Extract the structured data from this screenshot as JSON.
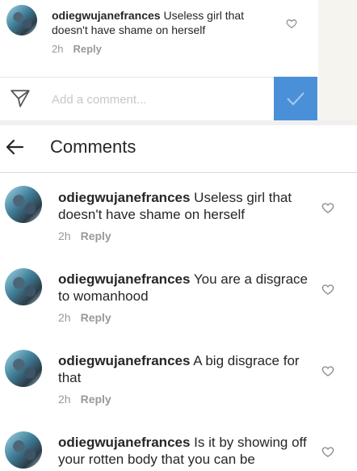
{
  "top_comment": {
    "username": "odiegwujanefrances",
    "text": " Useless girl that doesn't have shame on herself",
    "time": "2h",
    "reply_label": "Reply"
  },
  "composer": {
    "placeholder": "Add a comment..."
  },
  "header": {
    "title": "Comments"
  },
  "comments": [
    {
      "username": "odiegwujanefrances",
      "text": " Useless girl that doesn't have shame on herself",
      "time": "2h",
      "reply_label": "Reply"
    },
    {
      "username": "odiegwujanefrances",
      "text": " You are a disgrace to womanhood",
      "time": "2h",
      "reply_label": "Reply"
    },
    {
      "username": "odiegwujanefrances",
      "text": " A big disgrace for that",
      "time": "2h",
      "reply_label": "Reply"
    },
    {
      "username": "odiegwujanefrances",
      "text": " Is it by showing off your rotten body that you can be",
      "time": "",
      "reply_label": ""
    }
  ],
  "colors": {
    "accent": "#4a90d9",
    "text": "#262626",
    "muted": "#999999",
    "placeholder": "#c7c7c7"
  },
  "icons": {
    "back": "arrow-left-icon",
    "send": "paper-plane-icon",
    "like": "heart-outline-icon",
    "submit": "checkmark-icon"
  }
}
